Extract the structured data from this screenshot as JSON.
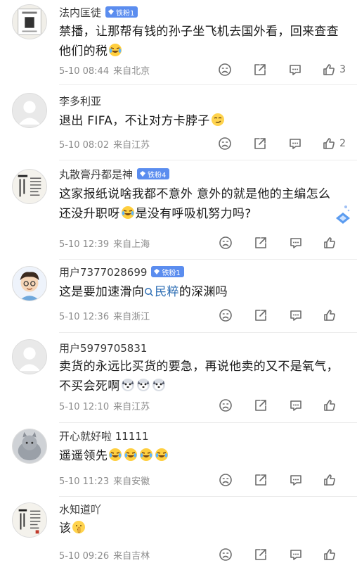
{
  "comments": [
    {
      "username": "法内匡徒",
      "badge": "铁粉1",
      "text": "禁播，让那帮有钱的孙子坐飞机去国外看，回来查查他们的税",
      "emojis": [
        "laugh-cry-emoji"
      ],
      "date": "5-10 08:44",
      "location": "来自北京",
      "likes": "3",
      "avatar": "chinese-scroll-avatar"
    },
    {
      "username": "李多利亚",
      "badge": "",
      "text": "退出 FIFA，不让对方卡脖子",
      "emojis": [
        "smirk-emoji"
      ],
      "date": "5-10 08:02",
      "location": "来自江苏",
      "likes": "2",
      "avatar": "default-avatar"
    },
    {
      "username": "丸散膏丹都是神",
      "badge": "铁粉4",
      "text_a": "这家报纸说啥我都不意外 意外的就是他的主编怎么还没升职呀",
      "text_b": "是没有呼吸机努力吗?",
      "emojis": [
        "laugh-cry-emoji"
      ],
      "date": "5-10 12:39",
      "location": "来自上海",
      "likes": "",
      "avatar": "calligraphy-avatar"
    },
    {
      "username": "用户7377028699",
      "badge": "铁粉1",
      "text_a": "这是要加速滑向",
      "mention": "民粹",
      "text_b": "的深渊吗",
      "date": "5-10 12:36",
      "location": "来自浙江",
      "likes": "",
      "avatar": "cartoon-boy-avatar"
    },
    {
      "username": "用户5979705831",
      "badge": "",
      "text": "卖货的永远比买货的要急，再说他卖的又不是氧气，不买会死啊",
      "emojis": [
        "husky-emoji",
        "husky-emoji",
        "husky-emoji"
      ],
      "date": "5-10 12:10",
      "location": "来自江苏",
      "likes": "",
      "avatar": "default-avatar"
    },
    {
      "username": "开心就好啦 11111",
      "badge": "",
      "text": "遥遥领先",
      "emojis": [
        "laugh-cry-emoji",
        "laugh-cry-emoji",
        "laugh-cry-emoji",
        "laugh-cry-emoji"
      ],
      "date": "5-10 11:23",
      "location": "来自安徽",
      "likes": "",
      "avatar": "cat-avatar"
    },
    {
      "username": "水知道吖",
      "badge": "",
      "text": "该",
      "emojis": [
        "shush-emoji"
      ],
      "date": "5-10 09:26",
      "location": "来自吉林",
      "likes": "",
      "avatar": "calligraphy-avatar"
    }
  ],
  "icons": {
    "dislike": "frown-face-icon",
    "share": "share-icon",
    "reply": "comment-bubble-icon",
    "like": "thumbs-up-icon"
  },
  "colors": {
    "badge": "#5b8def",
    "mention": "#2f6fb5",
    "meta": "#8c8c8c"
  }
}
